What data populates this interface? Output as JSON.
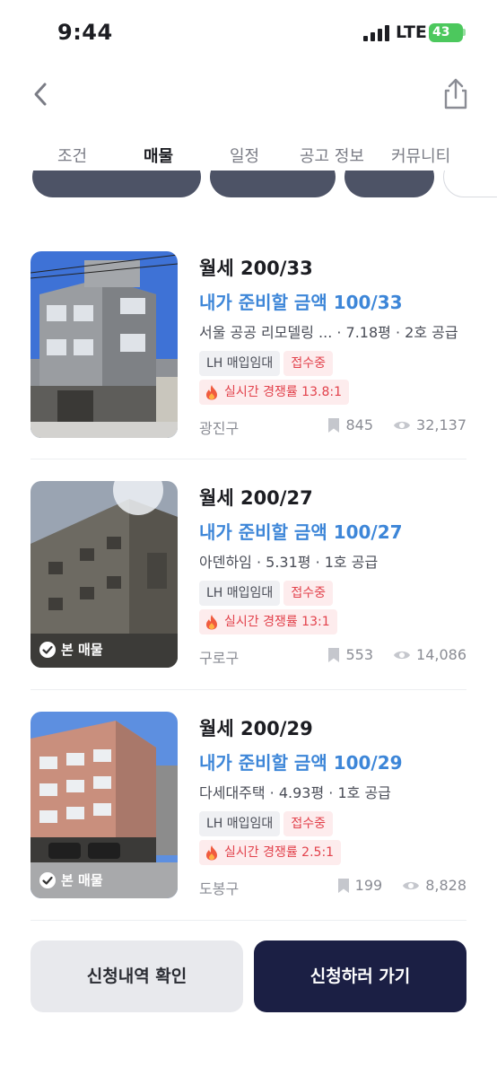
{
  "status_bar": {
    "time": "9:44",
    "network": "LTE",
    "battery": "43"
  },
  "tabs": [
    {
      "label": "조건"
    },
    {
      "label": "매물"
    },
    {
      "label": "일정"
    },
    {
      "label": "공고 정보"
    },
    {
      "label": "커뮤니티"
    }
  ],
  "active_tab": "매물",
  "listings": [
    {
      "price": "월세 200/33",
      "prepare": "내가 준비할 금액 100/33",
      "subtitle": "서울 공공 리모델링 ... · 7.18평 · 2호 공급",
      "type_tag": "LH 매입임대",
      "status_tag": "접수중",
      "competition": "실시간 경쟁률 13.8:1",
      "district": "광진구",
      "bookmarks": "845",
      "views": "32,137",
      "badge": ""
    },
    {
      "price": "월세 200/27",
      "prepare": "내가 준비할 금액 100/27",
      "subtitle": "아덴하임 · 5.31평 · 1호 공급",
      "type_tag": "LH 매입임대",
      "status_tag": "접수중",
      "competition": "실시간 경쟁률 13:1",
      "district": "구로구",
      "bookmarks": "553",
      "views": "14,086",
      "badge": "본 매물"
    },
    {
      "price": "월세 200/29",
      "prepare": "내가 준비할 금액 100/29",
      "subtitle": "다세대주택 · 4.93평 · 1호 공급",
      "type_tag": "LH 매입임대",
      "status_tag": "접수중",
      "competition": "실시간 경쟁률 2.5:1",
      "district": "도봉구",
      "bookmarks": "199",
      "views": "8,828",
      "badge": "본 매물"
    }
  ],
  "buttons": {
    "history": "신청내역 확인",
    "apply": "신청하러 가기"
  },
  "colors": {
    "accent_blue": "#3d86d8",
    "primary_navy": "#1b1f44",
    "tag_red": "#e2414b",
    "chip_dark": "#4d5366"
  },
  "icons": [
    "back-arrow-icon",
    "share-icon",
    "bookmark-icon",
    "eye-icon",
    "fire-icon",
    "check-circle-icon"
  ]
}
